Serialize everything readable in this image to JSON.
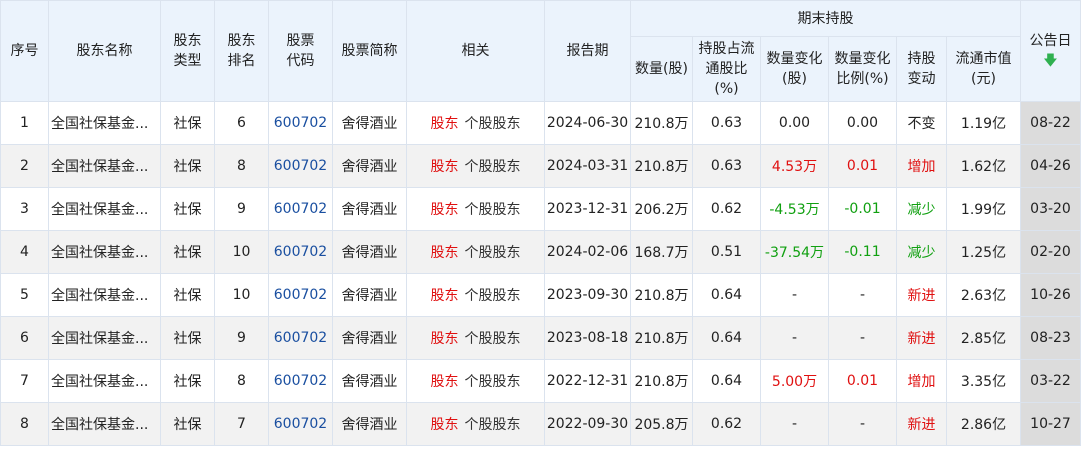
{
  "headers": {
    "index": "序号",
    "holder_name": "股东名称",
    "holder_type": [
      "股东",
      "类型"
    ],
    "rank": [
      "股东",
      "排名"
    ],
    "code": [
      "股票",
      "代码"
    ],
    "stock_name": "股票简称",
    "related": "相关",
    "report_date": "报告期",
    "period_end_group": "期末持股",
    "shares": "数量(股)",
    "ratio": [
      "持股占流",
      "通股比",
      "(%)"
    ],
    "qty_change": [
      "数量变化",
      "(股)"
    ],
    "qty_change_pct": [
      "数量变化",
      "比例(%)"
    ],
    "change_type": [
      "持股",
      "变动"
    ],
    "market_value": [
      "流通市值",
      "(元)"
    ],
    "announce_date": "公告日",
    "sort_icon": "arrow-down-icon"
  },
  "colors": {
    "header_bg": "#ebf3fc",
    "border": "#dbe3ee",
    "increase": "#e01010",
    "decrease": "#10a010",
    "code_link": "#1a4fa0",
    "sort_icon": "#2fb050"
  },
  "rows": [
    {
      "index": "1",
      "holder_name": "全国社保基金...",
      "holder_type": "社保",
      "rank": "6",
      "code": "600702",
      "stock_name": "舍得酒业",
      "link_holder": "股东",
      "link_stock_holders": "个股股东",
      "report_date": "2024-06-30",
      "shares": "210.8万",
      "ratio": "0.63",
      "qty_change": "0.00",
      "qty_change_pct": "0.00",
      "change_type": "不变",
      "market_value": "1.19亿",
      "announce_date": "08-22",
      "trend": "none"
    },
    {
      "index": "2",
      "holder_name": "全国社保基金...",
      "holder_type": "社保",
      "rank": "8",
      "code": "600702",
      "stock_name": "舍得酒业",
      "link_holder": "股东",
      "link_stock_holders": "个股股东",
      "report_date": "2024-03-31",
      "shares": "210.8万",
      "ratio": "0.63",
      "qty_change": "4.53万",
      "qty_change_pct": "0.01",
      "change_type": "增加",
      "market_value": "1.62亿",
      "announce_date": "04-26",
      "trend": "up"
    },
    {
      "index": "3",
      "holder_name": "全国社保基金...",
      "holder_type": "社保",
      "rank": "9",
      "code": "600702",
      "stock_name": "舍得酒业",
      "link_holder": "股东",
      "link_stock_holders": "个股股东",
      "report_date": "2023-12-31",
      "shares": "206.2万",
      "ratio": "0.62",
      "qty_change": "-4.53万",
      "qty_change_pct": "-0.01",
      "change_type": "减少",
      "market_value": "1.99亿",
      "announce_date": "03-20",
      "trend": "down"
    },
    {
      "index": "4",
      "holder_name": "全国社保基金...",
      "holder_type": "社保",
      "rank": "10",
      "code": "600702",
      "stock_name": "舍得酒业",
      "link_holder": "股东",
      "link_stock_holders": "个股股东",
      "report_date": "2024-02-06",
      "shares": "168.7万",
      "ratio": "0.51",
      "qty_change": "-37.54万",
      "qty_change_pct": "-0.11",
      "change_type": "减少",
      "market_value": "1.25亿",
      "announce_date": "02-20",
      "trend": "down"
    },
    {
      "index": "5",
      "holder_name": "全国社保基金...",
      "holder_type": "社保",
      "rank": "10",
      "code": "600702",
      "stock_name": "舍得酒业",
      "link_holder": "股东",
      "link_stock_holders": "个股股东",
      "report_date": "2023-09-30",
      "shares": "210.8万",
      "ratio": "0.64",
      "qty_change": "-",
      "qty_change_pct": "-",
      "change_type": "新进",
      "market_value": "2.63亿",
      "announce_date": "10-26",
      "trend": "new"
    },
    {
      "index": "6",
      "holder_name": "全国社保基金...",
      "holder_type": "社保",
      "rank": "9",
      "code": "600702",
      "stock_name": "舍得酒业",
      "link_holder": "股东",
      "link_stock_holders": "个股股东",
      "report_date": "2023-08-18",
      "shares": "210.8万",
      "ratio": "0.64",
      "qty_change": "-",
      "qty_change_pct": "-",
      "change_type": "新进",
      "market_value": "2.85亿",
      "announce_date": "08-23",
      "trend": "new"
    },
    {
      "index": "7",
      "holder_name": "全国社保基金...",
      "holder_type": "社保",
      "rank": "8",
      "code": "600702",
      "stock_name": "舍得酒业",
      "link_holder": "股东",
      "link_stock_holders": "个股股东",
      "report_date": "2022-12-31",
      "shares": "210.8万",
      "ratio": "0.64",
      "qty_change": "5.00万",
      "qty_change_pct": "0.01",
      "change_type": "增加",
      "market_value": "3.35亿",
      "announce_date": "03-22",
      "trend": "up"
    },
    {
      "index": "8",
      "holder_name": "全国社保基金...",
      "holder_type": "社保",
      "rank": "7",
      "code": "600702",
      "stock_name": "舍得酒业",
      "link_holder": "股东",
      "link_stock_holders": "个股股东",
      "report_date": "2022-09-30",
      "shares": "205.8万",
      "ratio": "0.62",
      "qty_change": "-",
      "qty_change_pct": "-",
      "change_type": "新进",
      "market_value": "2.86亿",
      "announce_date": "10-27",
      "trend": "new"
    }
  ]
}
